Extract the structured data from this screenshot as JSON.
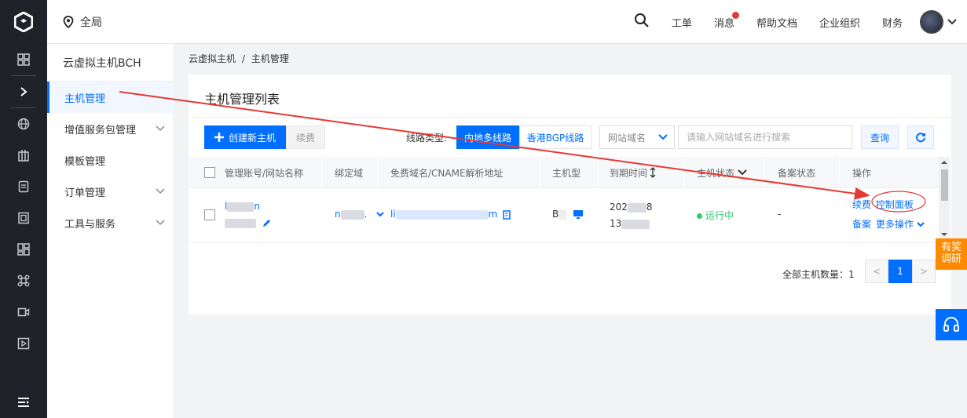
{
  "colors": {
    "accent": "#006eff",
    "rail": "#1f2329",
    "promo": "#ff8a00",
    "running": "#29cc6a",
    "annotation": "#e53935"
  },
  "rail": {
    "icons": [
      "grid-icon",
      "expand-chevron-icon",
      "globe-icon",
      "building-icon",
      "document-icon",
      "book-icon",
      "apps-icon",
      "command-icon",
      "video-icon",
      "play-icon"
    ],
    "bottom_icon": "menu-icon"
  },
  "topbar": {
    "region": "全局",
    "ticket": "工单",
    "messages": "消息",
    "help": "帮助文档",
    "org": "企业组织",
    "finance": "财务"
  },
  "sidebar": {
    "title": "云虚拟主机BCH",
    "items": [
      {
        "label": "主机管理",
        "active": true
      },
      {
        "label": "增值服务包管理",
        "expandable": true
      },
      {
        "label": "模板管理"
      },
      {
        "label": "订单管理",
        "expandable": true
      },
      {
        "label": "工具与服务",
        "expandable": true
      }
    ]
  },
  "breadcrumb": {
    "parent": "云虚拟主机",
    "sep": "/",
    "current": "主机管理"
  },
  "panel": {
    "title": "主机管理列表",
    "create_label": "创建新主机",
    "renew_label": "续费",
    "line_type_label": "线路类型:",
    "line_options": [
      "内地多线路",
      "香港BGP线路"
    ],
    "selected_line": "内地多线路",
    "search_field": "网站域名",
    "search_placeholder": "请输入网站域名进行搜索",
    "query_label": "查询"
  },
  "table": {
    "columns": [
      "管理账号/网站名称",
      "绑定域",
      "免费域名/CNAME解析地址",
      "主机型",
      "到期时间",
      "主机状态",
      "备案状态",
      "操作"
    ],
    "row": {
      "account_prefix": "l",
      "account_suffix": "n",
      "bound_domain_prefix": "n",
      "bound_domain_suffix": ".",
      "cname_prefix": "li",
      "cname_suffix": "m",
      "host_type_prefix": "B",
      "expiry_line1_prefix": "202",
      "expiry_line1_suffix": "8",
      "expiry_line2_prefix": "13",
      "status": "运行中",
      "icp_status": "-",
      "actions": {
        "renew": "续费",
        "control_panel": "控制面板",
        "icp": "备案",
        "more": "更多操作"
      }
    }
  },
  "pagination": {
    "total_label": "全部主机数量：",
    "total": "1",
    "prev": "<",
    "current_page": "1",
    "next": ">"
  },
  "widgets": {
    "promo_line1": "有奖",
    "promo_line2": "调研"
  }
}
